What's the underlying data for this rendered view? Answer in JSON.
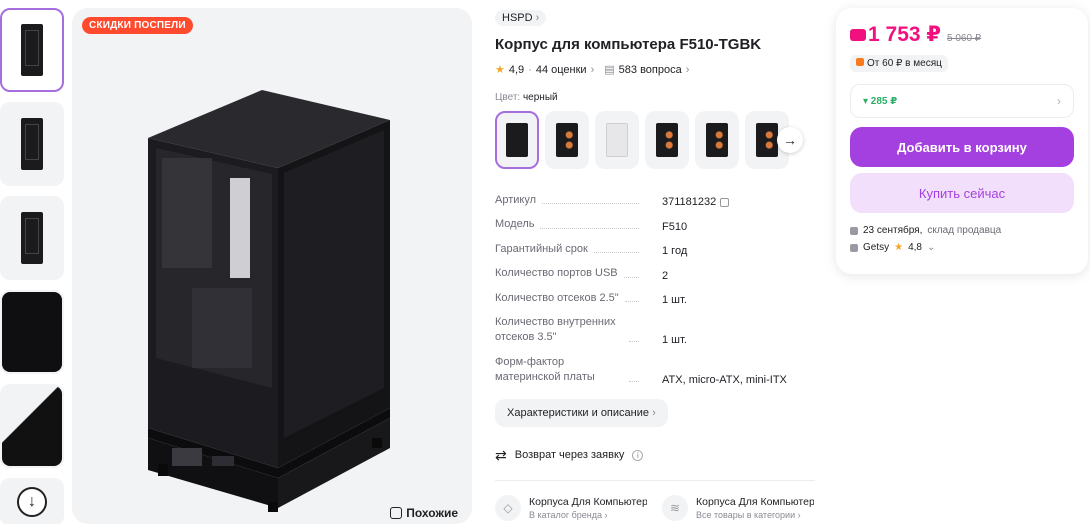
{
  "gallery": {
    "sale_badge": "СКИДКИ ПОСПЕЛИ",
    "similar_label": "Похожие",
    "thumbnails": [
      "thumb-front",
      "thumb-side",
      "thumb-angle",
      "thumb-detail",
      "thumb-corner"
    ]
  },
  "product": {
    "brand": "HSPD",
    "title": "Корпус для компьютера F510-TGBK",
    "rating": "4,9",
    "reviews": "44 оценки",
    "questions": "583 вопроса",
    "color_label": "Цвет:",
    "color_value": "черный",
    "specs": [
      {
        "k": "Артикул",
        "v": "371181232"
      },
      {
        "k": "Модель",
        "v": "F510"
      },
      {
        "k": "Гарантийный срок",
        "v": "1 год"
      },
      {
        "k": "Количество портов USB",
        "v": "2"
      },
      {
        "k": "Количество отсеков 2.5\"",
        "v": "1 шт."
      },
      {
        "k": "Количество внутренних отсеков 3.5\"",
        "v": "1 шт."
      },
      {
        "k": "Форм-фактор материнской платы",
        "v": "ATX, micro-ATX, mini-ITX"
      }
    ],
    "chars_button": "Характеристики и описание",
    "return_text": "Возврат через заявку",
    "categories": [
      {
        "title": "Корпуса Для Компьютеров",
        "sub": "В каталог бренда"
      },
      {
        "title": "Корпуса Для Компьютеров",
        "sub": "Все товары в категории"
      }
    ]
  },
  "buy": {
    "price": "1 753 ₽",
    "old_price": "5 060 ₽",
    "installment": "От 60 ₽ в месяц",
    "bonus": "▾ 285 ₽",
    "add_to_cart": "Добавить в корзину",
    "buy_now": "Купить сейчас",
    "delivery_date": "23 сентября,",
    "delivery_source": "склад продавца",
    "seller": "Getsy",
    "seller_rating": "4,8"
  },
  "colors": {
    "accent": "#a540e0",
    "price": "#f1117e",
    "sale": "#ff4a2e",
    "bonus": "#2bae66"
  }
}
